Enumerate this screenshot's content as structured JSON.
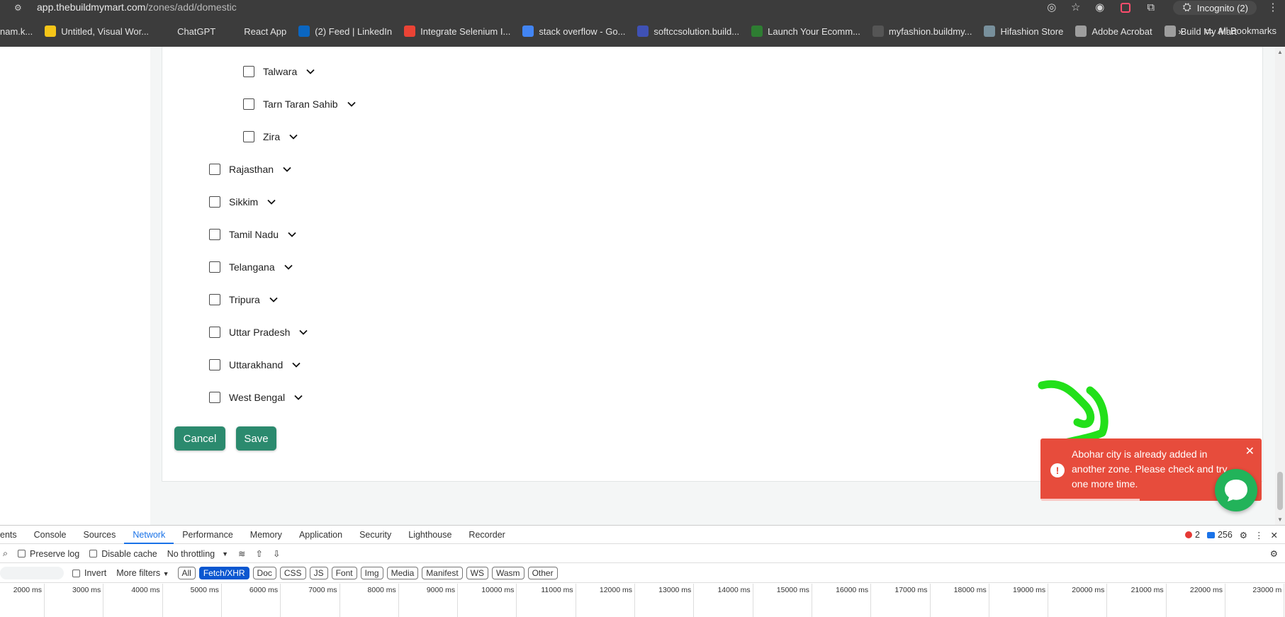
{
  "browser": {
    "url_host": "app.thebuildmymart.com",
    "url_path": "/zones/add/domestic",
    "incognito_label": "Incognito (2)",
    "bookmarks": [
      {
        "label": "nam.k...",
        "color": "#3c3c3c"
      },
      {
        "label": "Untitled, Visual Wor...",
        "color": "#f5c518"
      },
      {
        "label": "ChatGPT",
        "color": "#3c3c3c"
      },
      {
        "label": "React App",
        "color": "#3c3c3c"
      },
      {
        "label": "(2) Feed | LinkedIn",
        "color": "#0a66c2"
      },
      {
        "label": "Integrate Selenium I...",
        "color": "#ea4335"
      },
      {
        "label": "stack overflow - Go...",
        "color": "#4285f4"
      },
      {
        "label": "softccsolution.build...",
        "color": "#3f51b5"
      },
      {
        "label": "Launch Your Ecomm...",
        "color": "#2e7d32"
      },
      {
        "label": "myfashion.buildmy...",
        "color": "#555555"
      },
      {
        "label": "Hifashion Store",
        "color": "#78909c"
      },
      {
        "label": "Adobe Acrobat",
        "color": "#9e9e9e"
      },
      {
        "label": "Build My Mart",
        "color": "#9e9e9e"
      }
    ],
    "all_bookmarks_label": "All Bookmarks",
    "more_label": "»"
  },
  "zones": {
    "cities": [
      "Talwara",
      "Tarn Taran Sahib",
      "Zira"
    ],
    "states": [
      "Rajasthan",
      "Sikkim",
      "Tamil Nadu",
      "Telangana",
      "Tripura",
      "Uttar Pradesh",
      "Uttarakhand",
      "West Bengal"
    ],
    "cancel_label": "Cancel",
    "save_label": "Save"
  },
  "toast": {
    "message": "Abohar city is already added in another zone. Please check and try one more time.",
    "icon": "!",
    "close": "✕",
    "color": "#e74c3c"
  },
  "devtools": {
    "tabs": [
      "ents",
      "Console",
      "Sources",
      "Network",
      "Performance",
      "Memory",
      "Application",
      "Security",
      "Lighthouse",
      "Recorder"
    ],
    "active_tab": "Network",
    "errors": "2",
    "messages": "256",
    "preserve_log": "Preserve log",
    "disable_cache": "Disable cache",
    "throttling": "No throttling",
    "invert": "Invert",
    "more_filters": "More filters",
    "filters": [
      "All",
      "Fetch/XHR",
      "Doc",
      "CSS",
      "JS",
      "Font",
      "Img",
      "Media",
      "Manifest",
      "WS",
      "Wasm",
      "Other"
    ],
    "active_filter": "Fetch/XHR",
    "timeline": [
      "2000 ms",
      "3000 ms",
      "4000 ms",
      "5000 ms",
      "6000 ms",
      "7000 ms",
      "8000 ms",
      "9000 ms",
      "10000 ms",
      "11000 ms",
      "12000 ms",
      "13000 ms",
      "14000 ms",
      "15000 ms",
      "16000 ms",
      "17000 ms",
      "18000 ms",
      "19000 ms",
      "20000 ms",
      "21000 ms",
      "22000 ms",
      "23000 m"
    ]
  }
}
